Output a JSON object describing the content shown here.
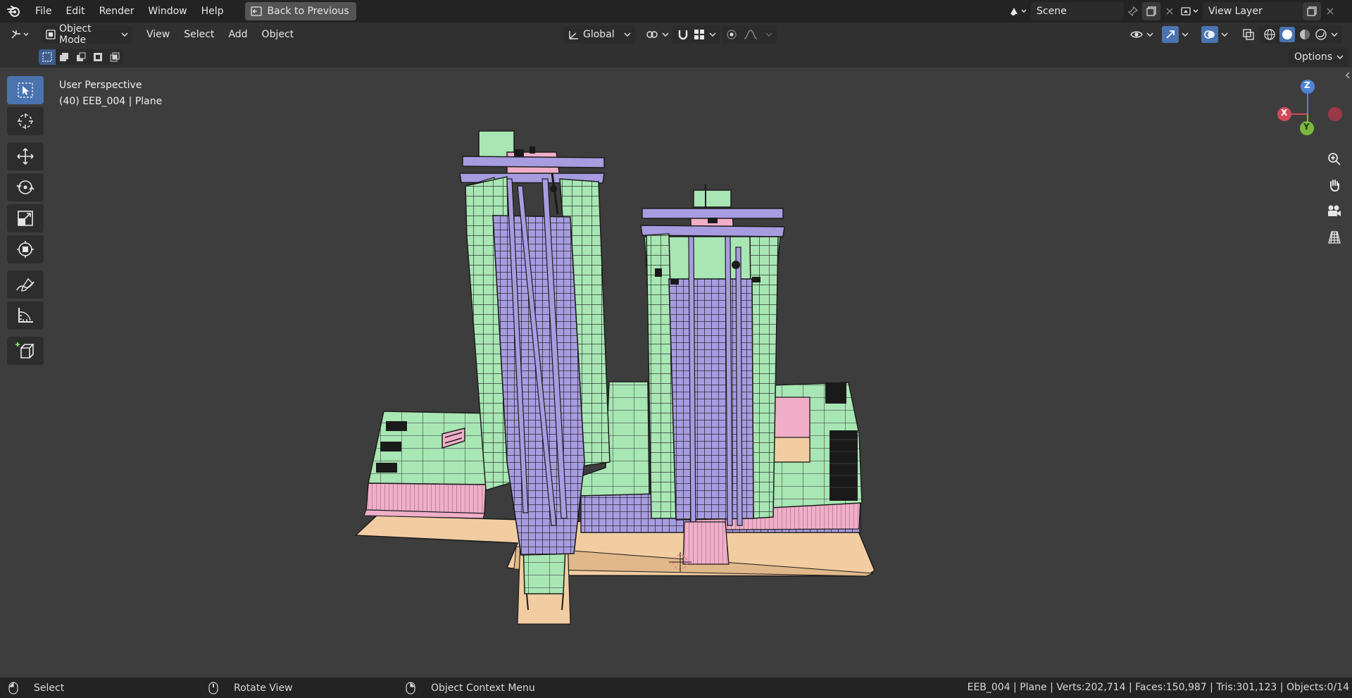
{
  "topbar": {
    "menus": [
      "File",
      "Edit",
      "Render",
      "Window",
      "Help"
    ],
    "back_button": "Back to Previous",
    "scene_name": "Scene",
    "view_layer_name": "View Layer"
  },
  "header": {
    "mode": "Object Mode",
    "menus": [
      "View",
      "Select",
      "Add",
      "Object"
    ],
    "transform_orientation": "Global",
    "options_label": "Options"
  },
  "viewport": {
    "perspective_label": "User Perspective",
    "object_label": "(40) EEB_004 | Plane"
  },
  "gizmo": {
    "z_label": "Z",
    "x_label": "X",
    "y_label": "Y"
  },
  "statusbar": {
    "select_label": "Select",
    "rotate_label": "Rotate View",
    "context_label": "Object Context Menu",
    "stats": "EEB_004 | Plane | Verts:202,714 | Faces:150,987 | Tris:301,123 | Objects:0/14"
  },
  "colors": {
    "accent": "#4a73b0",
    "facade_green": "#a8e6b4",
    "facade_purple": "#a89ce0",
    "pink": "#f0aec8",
    "base_tan": "#f2cda2"
  }
}
